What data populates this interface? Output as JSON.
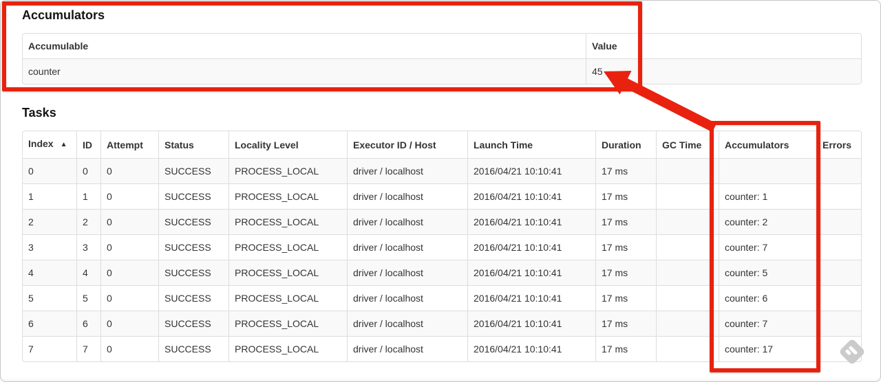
{
  "accumulators": {
    "title": "Accumulators",
    "headers": [
      "Accumulable",
      "Value"
    ],
    "rows": [
      {
        "accumulable": "counter",
        "value": "45"
      }
    ]
  },
  "tasks": {
    "title": "Tasks",
    "headers": [
      "Index",
      "ID",
      "Attempt",
      "Status",
      "Locality Level",
      "Executor ID / Host",
      "Launch Time",
      "Duration",
      "GC Time",
      "Accumulators",
      "Errors"
    ],
    "sort_icon": "▲",
    "rows": [
      {
        "index": "0",
        "id": "0",
        "attempt": "0",
        "status": "SUCCESS",
        "locality_level": "PROCESS_LOCAL",
        "executor_id_host": "driver / localhost",
        "launch_time": "2016/04/21 10:10:41",
        "duration": "17 ms",
        "gc_time": "",
        "accumulators": "",
        "errors": ""
      },
      {
        "index": "1",
        "id": "1",
        "attempt": "0",
        "status": "SUCCESS",
        "locality_level": "PROCESS_LOCAL",
        "executor_id_host": "driver / localhost",
        "launch_time": "2016/04/21 10:10:41",
        "duration": "17 ms",
        "gc_time": "",
        "accumulators": "counter: 1",
        "errors": ""
      },
      {
        "index": "2",
        "id": "2",
        "attempt": "0",
        "status": "SUCCESS",
        "locality_level": "PROCESS_LOCAL",
        "executor_id_host": "driver / localhost",
        "launch_time": "2016/04/21 10:10:41",
        "duration": "17 ms",
        "gc_time": "",
        "accumulators": "counter: 2",
        "errors": ""
      },
      {
        "index": "3",
        "id": "3",
        "attempt": "0",
        "status": "SUCCESS",
        "locality_level": "PROCESS_LOCAL",
        "executor_id_host": "driver / localhost",
        "launch_time": "2016/04/21 10:10:41",
        "duration": "17 ms",
        "gc_time": "",
        "accumulators": "counter: 7",
        "errors": ""
      },
      {
        "index": "4",
        "id": "4",
        "attempt": "0",
        "status": "SUCCESS",
        "locality_level": "PROCESS_LOCAL",
        "executor_id_host": "driver / localhost",
        "launch_time": "2016/04/21 10:10:41",
        "duration": "17 ms",
        "gc_time": "",
        "accumulators": "counter: 5",
        "errors": ""
      },
      {
        "index": "5",
        "id": "5",
        "attempt": "0",
        "status": "SUCCESS",
        "locality_level": "PROCESS_LOCAL",
        "executor_id_host": "driver / localhost",
        "launch_time": "2016/04/21 10:10:41",
        "duration": "17 ms",
        "gc_time": "",
        "accumulators": "counter: 6",
        "errors": ""
      },
      {
        "index": "6",
        "id": "6",
        "attempt": "0",
        "status": "SUCCESS",
        "locality_level": "PROCESS_LOCAL",
        "executor_id_host": "driver / localhost",
        "launch_time": "2016/04/21 10:10:41",
        "duration": "17 ms",
        "gc_time": "",
        "accumulators": "counter: 7",
        "errors": ""
      },
      {
        "index": "7",
        "id": "7",
        "attempt": "0",
        "status": "SUCCESS",
        "locality_level": "PROCESS_LOCAL",
        "executor_id_host": "driver / localhost",
        "launch_time": "2016/04/21 10:10:41",
        "duration": "17 ms",
        "gc_time": "",
        "accumulators": "counter: 17",
        "errors": ""
      }
    ]
  },
  "annotations": {
    "accent_color": "#e8220e",
    "watermark_icon": "skitch-diamond-logo",
    "watermark_color": "#cbcbcb",
    "table_border_color": "#dddddd",
    "stripe_color": "#f9f9f9"
  }
}
